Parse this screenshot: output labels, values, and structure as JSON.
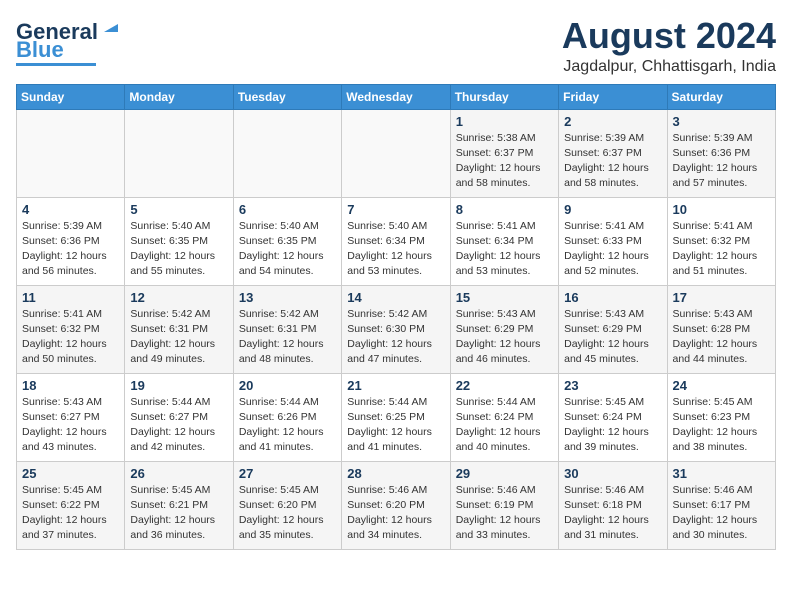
{
  "header": {
    "logo_line1": "General",
    "logo_line2": "Blue",
    "month_year": "August 2024",
    "location": "Jagdalpur, Chhattisgarh, India"
  },
  "days_of_week": [
    "Sunday",
    "Monday",
    "Tuesday",
    "Wednesday",
    "Thursday",
    "Friday",
    "Saturday"
  ],
  "weeks": [
    [
      {
        "day": "",
        "detail": ""
      },
      {
        "day": "",
        "detail": ""
      },
      {
        "day": "",
        "detail": ""
      },
      {
        "day": "",
        "detail": ""
      },
      {
        "day": "1",
        "detail": "Sunrise: 5:38 AM\nSunset: 6:37 PM\nDaylight: 12 hours\nand 58 minutes."
      },
      {
        "day": "2",
        "detail": "Sunrise: 5:39 AM\nSunset: 6:37 PM\nDaylight: 12 hours\nand 58 minutes."
      },
      {
        "day": "3",
        "detail": "Sunrise: 5:39 AM\nSunset: 6:36 PM\nDaylight: 12 hours\nand 57 minutes."
      }
    ],
    [
      {
        "day": "4",
        "detail": "Sunrise: 5:39 AM\nSunset: 6:36 PM\nDaylight: 12 hours\nand 56 minutes."
      },
      {
        "day": "5",
        "detail": "Sunrise: 5:40 AM\nSunset: 6:35 PM\nDaylight: 12 hours\nand 55 minutes."
      },
      {
        "day": "6",
        "detail": "Sunrise: 5:40 AM\nSunset: 6:35 PM\nDaylight: 12 hours\nand 54 minutes."
      },
      {
        "day": "7",
        "detail": "Sunrise: 5:40 AM\nSunset: 6:34 PM\nDaylight: 12 hours\nand 53 minutes."
      },
      {
        "day": "8",
        "detail": "Sunrise: 5:41 AM\nSunset: 6:34 PM\nDaylight: 12 hours\nand 53 minutes."
      },
      {
        "day": "9",
        "detail": "Sunrise: 5:41 AM\nSunset: 6:33 PM\nDaylight: 12 hours\nand 52 minutes."
      },
      {
        "day": "10",
        "detail": "Sunrise: 5:41 AM\nSunset: 6:32 PM\nDaylight: 12 hours\nand 51 minutes."
      }
    ],
    [
      {
        "day": "11",
        "detail": "Sunrise: 5:41 AM\nSunset: 6:32 PM\nDaylight: 12 hours\nand 50 minutes."
      },
      {
        "day": "12",
        "detail": "Sunrise: 5:42 AM\nSunset: 6:31 PM\nDaylight: 12 hours\nand 49 minutes."
      },
      {
        "day": "13",
        "detail": "Sunrise: 5:42 AM\nSunset: 6:31 PM\nDaylight: 12 hours\nand 48 minutes."
      },
      {
        "day": "14",
        "detail": "Sunrise: 5:42 AM\nSunset: 6:30 PM\nDaylight: 12 hours\nand 47 minutes."
      },
      {
        "day": "15",
        "detail": "Sunrise: 5:43 AM\nSunset: 6:29 PM\nDaylight: 12 hours\nand 46 minutes."
      },
      {
        "day": "16",
        "detail": "Sunrise: 5:43 AM\nSunset: 6:29 PM\nDaylight: 12 hours\nand 45 minutes."
      },
      {
        "day": "17",
        "detail": "Sunrise: 5:43 AM\nSunset: 6:28 PM\nDaylight: 12 hours\nand 44 minutes."
      }
    ],
    [
      {
        "day": "18",
        "detail": "Sunrise: 5:43 AM\nSunset: 6:27 PM\nDaylight: 12 hours\nand 43 minutes."
      },
      {
        "day": "19",
        "detail": "Sunrise: 5:44 AM\nSunset: 6:27 PM\nDaylight: 12 hours\nand 42 minutes."
      },
      {
        "day": "20",
        "detail": "Sunrise: 5:44 AM\nSunset: 6:26 PM\nDaylight: 12 hours\nand 41 minutes."
      },
      {
        "day": "21",
        "detail": "Sunrise: 5:44 AM\nSunset: 6:25 PM\nDaylight: 12 hours\nand 41 minutes."
      },
      {
        "day": "22",
        "detail": "Sunrise: 5:44 AM\nSunset: 6:24 PM\nDaylight: 12 hours\nand 40 minutes."
      },
      {
        "day": "23",
        "detail": "Sunrise: 5:45 AM\nSunset: 6:24 PM\nDaylight: 12 hours\nand 39 minutes."
      },
      {
        "day": "24",
        "detail": "Sunrise: 5:45 AM\nSunset: 6:23 PM\nDaylight: 12 hours\nand 38 minutes."
      }
    ],
    [
      {
        "day": "25",
        "detail": "Sunrise: 5:45 AM\nSunset: 6:22 PM\nDaylight: 12 hours\nand 37 minutes."
      },
      {
        "day": "26",
        "detail": "Sunrise: 5:45 AM\nSunset: 6:21 PM\nDaylight: 12 hours\nand 36 minutes."
      },
      {
        "day": "27",
        "detail": "Sunrise: 5:45 AM\nSunset: 6:20 PM\nDaylight: 12 hours\nand 35 minutes."
      },
      {
        "day": "28",
        "detail": "Sunrise: 5:46 AM\nSunset: 6:20 PM\nDaylight: 12 hours\nand 34 minutes."
      },
      {
        "day": "29",
        "detail": "Sunrise: 5:46 AM\nSunset: 6:19 PM\nDaylight: 12 hours\nand 33 minutes."
      },
      {
        "day": "30",
        "detail": "Sunrise: 5:46 AM\nSunset: 6:18 PM\nDaylight: 12 hours\nand 31 minutes."
      },
      {
        "day": "31",
        "detail": "Sunrise: 5:46 AM\nSunset: 6:17 PM\nDaylight: 12 hours\nand 30 minutes."
      }
    ]
  ]
}
